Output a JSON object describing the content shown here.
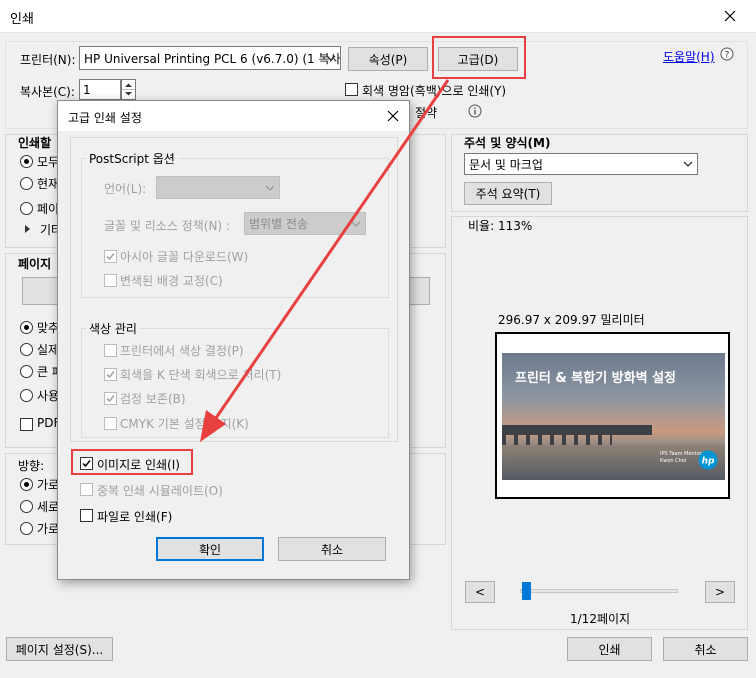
{
  "window": {
    "title": "인쇄"
  },
  "printer": {
    "label": "프린터(N):",
    "selected": "HP Universal Printing PCL 6 (v6.7.0) (1 복사)",
    "properties_button": "속성(P)",
    "advanced_button": "고급(D)",
    "help_link": "도움말(H)"
  },
  "copies": {
    "label": "복사본(C):",
    "value": "1"
  },
  "grayscale": {
    "label": "회색 명암(흑백)으로 인쇄(Y)",
    "checked": false
  },
  "ink_save": {
    "label": "절약"
  },
  "left_panel": {
    "pages_heading": "인쇄할",
    "pages_options": [
      "모두",
      "현재",
      "페이",
      "기타"
    ],
    "sizing_heading": "페이지",
    "sizing_options": [
      "맞추",
      "실제",
      "큰 페",
      "사용"
    ],
    "pdf_label": "PDF",
    "orientation_heading": "방향:",
    "orientation_options": [
      "가로",
      "세로",
      "가로"
    ]
  },
  "comments": {
    "heading": "주석 및 양식(M)",
    "selected": "문서 및 마크업",
    "summary_button": "주석 요약(T)"
  },
  "preview": {
    "scale": "비율: 113%",
    "dimensions": "296.97 x 209.97 밀리미터",
    "slide_title": "프린터 & 복합기 방화벽 설정",
    "slide_caption_1": "IPS Team Mentor",
    "slide_caption_2": "Kwon Choi",
    "page_indicator": "1/12페이지",
    "prev_button": "<",
    "next_button": ">",
    "slider_position": 0.0
  },
  "footer": {
    "page_setup_button": "페이지 설정(S)...",
    "print_button": "인쇄",
    "cancel_button": "취소"
  },
  "dialog": {
    "title": "고급 인쇄 설정",
    "postscript_group": "PostScript 옵션",
    "language_label": "언어(L):",
    "language_value": "",
    "font_policy_label": "글꼴 및 리소스 정책(N) :",
    "font_policy_value": "범위별 전송",
    "asian_font_label": "아시아 글꼴 다운로드(W)",
    "asian_font_checked": true,
    "bg_correction_label": "변색된 배경 교정(C)",
    "bg_correction_checked": false,
    "color_group": "색상 관리",
    "printer_color_label": "프린터에서 색상 결정(P)",
    "printer_color_checked": false,
    "gray_k_label": "회색을 K 단색 회색으로 처리(T)",
    "gray_k_checked": true,
    "black_preserve_label": "검정 보존(B)",
    "black_preserve_checked": true,
    "cmyk_label": "CMYK 기본 설정 유지(K)",
    "cmyk_checked": false,
    "print_as_image_label": "이미지로 인쇄(I)",
    "print_as_image_checked": true,
    "overprint_label": "중복 인쇄 시뮬레이트(O)",
    "overprint_checked": false,
    "print_to_file_label": "파일로 인쇄(F)",
    "print_to_file_checked": false,
    "ok_button": "확인",
    "cancel_button": "취소"
  },
  "colors": {
    "highlight": "#e8403f",
    "accent": "#0078d7",
    "link": "#0000ee"
  }
}
